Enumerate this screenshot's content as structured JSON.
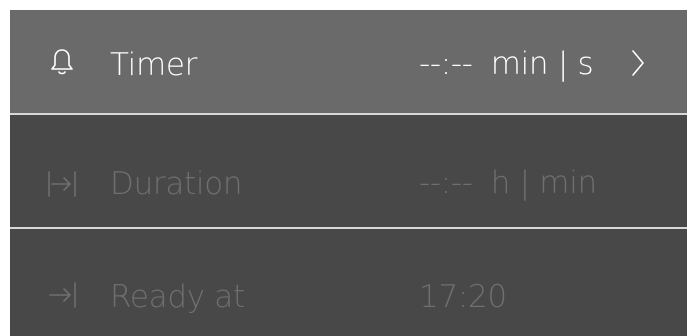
{
  "rows": [
    {
      "label": "Timer",
      "value": "--:--",
      "unit": "min | s",
      "icon": "bell-icon",
      "active": true
    },
    {
      "label": "Duration",
      "value": "--:--",
      "unit": "h | min",
      "icon": "duration-bracket-arrow-icon",
      "active": false
    },
    {
      "label": "Ready at",
      "value": "17:20",
      "unit": "",
      "icon": "ready-at-arrow-icon",
      "active": false
    }
  ],
  "colors": {
    "panel_bg": "#484848",
    "active_row_bg": "#6a6a6a",
    "active_text": "#ffffff",
    "inactive_text": "#6f6f6f",
    "divider": "#d8d8d8"
  }
}
